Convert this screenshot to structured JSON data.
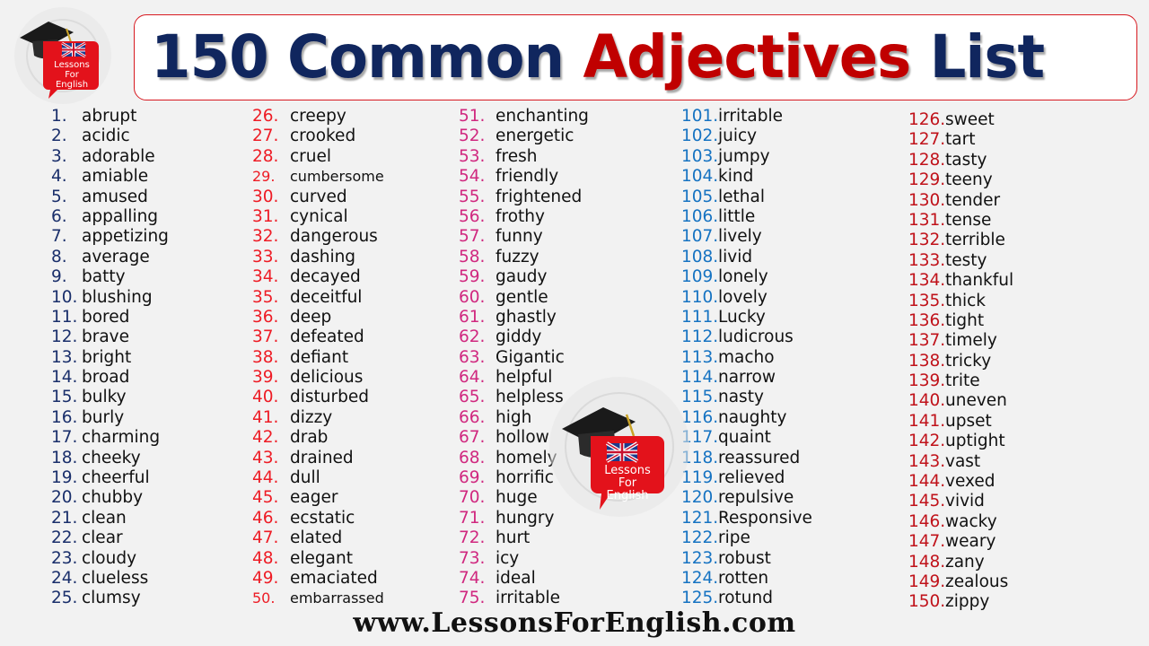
{
  "title": {
    "part1": "150 Common ",
    "accent": "Adjectives",
    "part2": " List"
  },
  "logo": {
    "line1": "Lessons",
    "line2": "For",
    "line3": "English",
    "icon": "graduation-cap-uk-flag-speech-bubble"
  },
  "colors": {
    "title_navy": "#10265e",
    "title_red": "#c00000",
    "col1_number": "#1a2f6b",
    "col2_number": "#ee1c25",
    "col3_number": "#d0287f",
    "col4_number": "#1673c2",
    "col5_number": "#c0121a",
    "logo_red": "#e3121b"
  },
  "columns": [
    [
      {
        "num": "1.",
        "word": "abrupt"
      },
      {
        "num": "2.",
        "word": "acidic"
      },
      {
        "num": "3.",
        "word": "adorable"
      },
      {
        "num": "4.",
        "word": "amiable"
      },
      {
        "num": "5.",
        "word": "amused"
      },
      {
        "num": "6.",
        "word": "appalling"
      },
      {
        "num": "7.",
        "word": "appetizing"
      },
      {
        "num": "8.",
        "word": "average"
      },
      {
        "num": "9.",
        "word": "batty"
      },
      {
        "num": "10.",
        "word": "blushing"
      },
      {
        "num": "11.",
        "word": "bored"
      },
      {
        "num": "12.",
        "word": "brave"
      },
      {
        "num": "13.",
        "word": "bright"
      },
      {
        "num": "14.",
        "word": "broad"
      },
      {
        "num": "15.",
        "word": "bulky"
      },
      {
        "num": "16.",
        "word": "burly"
      },
      {
        "num": "17.",
        "word": "charming"
      },
      {
        "num": "18.",
        "word": "cheeky"
      },
      {
        "num": "19.",
        "word": "cheerful"
      },
      {
        "num": "20.",
        "word": "chubby"
      },
      {
        "num": "21.",
        "word": "clean"
      },
      {
        "num": "22.",
        "word": "clear"
      },
      {
        "num": "23.",
        "word": "cloudy"
      },
      {
        "num": "24.",
        "word": "clueless"
      },
      {
        "num": "25.",
        "word": "clumsy"
      }
    ],
    [
      {
        "num": "26.",
        "word": "creepy"
      },
      {
        "num": "27.",
        "word": "crooked"
      },
      {
        "num": "28.",
        "word": "cruel"
      },
      {
        "num": "29.",
        "word": "cumbersome"
      },
      {
        "num": "30.",
        "word": "curved"
      },
      {
        "num": "31.",
        "word": "cynical"
      },
      {
        "num": "32.",
        "word": "dangerous"
      },
      {
        "num": "33.",
        "word": "dashing"
      },
      {
        "num": "34.",
        "word": "decayed"
      },
      {
        "num": "35.",
        "word": "deceitful"
      },
      {
        "num": "36.",
        "word": "deep"
      },
      {
        "num": "37.",
        "word": "defeated"
      },
      {
        "num": "38.",
        "word": "defiant"
      },
      {
        "num": "39.",
        "word": "delicious"
      },
      {
        "num": "40.",
        "word": "disturbed"
      },
      {
        "num": "41.",
        "word": "dizzy"
      },
      {
        "num": "42.",
        "word": "drab"
      },
      {
        "num": "43.",
        "word": "drained"
      },
      {
        "num": "44.",
        "word": "dull"
      },
      {
        "num": "45.",
        "word": "eager"
      },
      {
        "num": "46.",
        "word": "ecstatic"
      },
      {
        "num": "47.",
        "word": "elated"
      },
      {
        "num": "48.",
        "word": "elegant"
      },
      {
        "num": "49.",
        "word": "emaciated"
      },
      {
        "num": "50.",
        "word": "embarrassed"
      }
    ],
    [
      {
        "num": "51.",
        "word": "enchanting"
      },
      {
        "num": "52.",
        "word": "energetic"
      },
      {
        "num": "53.",
        "word": "fresh"
      },
      {
        "num": "54.",
        "word": "friendly"
      },
      {
        "num": "55.",
        "word": "frightened"
      },
      {
        "num": "56.",
        "word": "frothy"
      },
      {
        "num": "57.",
        "word": "funny"
      },
      {
        "num": "58.",
        "word": "fuzzy"
      },
      {
        "num": "59.",
        "word": "gaudy"
      },
      {
        "num": "60.",
        "word": "gentle"
      },
      {
        "num": "61.",
        "word": "ghastly"
      },
      {
        "num": "62.",
        "word": "giddy"
      },
      {
        "num": "63.",
        "word": "Gigantic"
      },
      {
        "num": "64.",
        "word": "helpful"
      },
      {
        "num": "65.",
        "word": "helpless"
      },
      {
        "num": "66.",
        "word": "high"
      },
      {
        "num": "67.",
        "word": "hollow"
      },
      {
        "num": "68.",
        "word": "homely"
      },
      {
        "num": "69.",
        "word": "horrific"
      },
      {
        "num": "70.",
        "word": "huge"
      },
      {
        "num": "71.",
        "word": "hungry"
      },
      {
        "num": "72.",
        "word": "hurt"
      },
      {
        "num": "73.",
        "word": "icy"
      },
      {
        "num": "74.",
        "word": "ideal"
      },
      {
        "num": "75.",
        "word": "irritable"
      }
    ],
    [
      {
        "num": "101.",
        "word": "irritable"
      },
      {
        "num": "102.",
        "word": "juicy"
      },
      {
        "num": "103.",
        "word": "jumpy"
      },
      {
        "num": "104.",
        "word": "kind"
      },
      {
        "num": "105.",
        "word": "lethal"
      },
      {
        "num": "106.",
        "word": "little"
      },
      {
        "num": "107.",
        "word": "lively"
      },
      {
        "num": "108.",
        "word": "livid"
      },
      {
        "num": "109.",
        "word": "lonely"
      },
      {
        "num": "110.",
        "word": "lovely"
      },
      {
        "num": "111.",
        "word": "Lucky"
      },
      {
        "num": "112.",
        "word": "ludicrous"
      },
      {
        "num": "113.",
        "word": "macho"
      },
      {
        "num": "114.",
        "word": "narrow"
      },
      {
        "num": "115.",
        "word": "nasty"
      },
      {
        "num": "116.",
        "word": "naughty"
      },
      {
        "num": "117.",
        "word": "quaint"
      },
      {
        "num": "118.",
        "word": "reassured"
      },
      {
        "num": "119.",
        "word": "relieved"
      },
      {
        "num": "120.",
        "word": "repulsive"
      },
      {
        "num": "121.",
        "word": "Responsive"
      },
      {
        "num": "122.",
        "word": "ripe"
      },
      {
        "num": "123.",
        "word": "robust"
      },
      {
        "num": "124.",
        "word": "rotten"
      },
      {
        "num": "125.",
        "word": "rotund"
      }
    ],
    [
      {
        "num": "126.",
        "word": "sweet"
      },
      {
        "num": "127.",
        "word": "tart"
      },
      {
        "num": "128.",
        "word": "tasty"
      },
      {
        "num": "129.",
        "word": "teeny"
      },
      {
        "num": "130.",
        "word": "tender"
      },
      {
        "num": "131.",
        "word": "tense"
      },
      {
        "num": "132.",
        "word": "terrible"
      },
      {
        "num": "133.",
        "word": "testy"
      },
      {
        "num": "134.",
        "word": "thankful"
      },
      {
        "num": "135.",
        "word": "thick"
      },
      {
        "num": "136.",
        "word": "tight"
      },
      {
        "num": "137.",
        "word": "timely"
      },
      {
        "num": "138.",
        "word": "tricky"
      },
      {
        "num": "139.",
        "word": "trite"
      },
      {
        "num": "140.",
        "word": "uneven"
      },
      {
        "num": "141.",
        "word": "upset"
      },
      {
        "num": "142.",
        "word": "uptight"
      },
      {
        "num": "143.",
        "word": "vast"
      },
      {
        "num": "144.",
        "word": "vexed"
      },
      {
        "num": "145.",
        "word": "vivid"
      },
      {
        "num": "146.",
        "word": "wacky"
      },
      {
        "num": "147.",
        "word": "weary"
      },
      {
        "num": "148.",
        "word": "zany"
      },
      {
        "num": "149.",
        "word": "zealous"
      },
      {
        "num": "150.",
        "word": "zippy"
      }
    ]
  ],
  "footer": {
    "url": "www.LessonsForEnglish.com"
  }
}
